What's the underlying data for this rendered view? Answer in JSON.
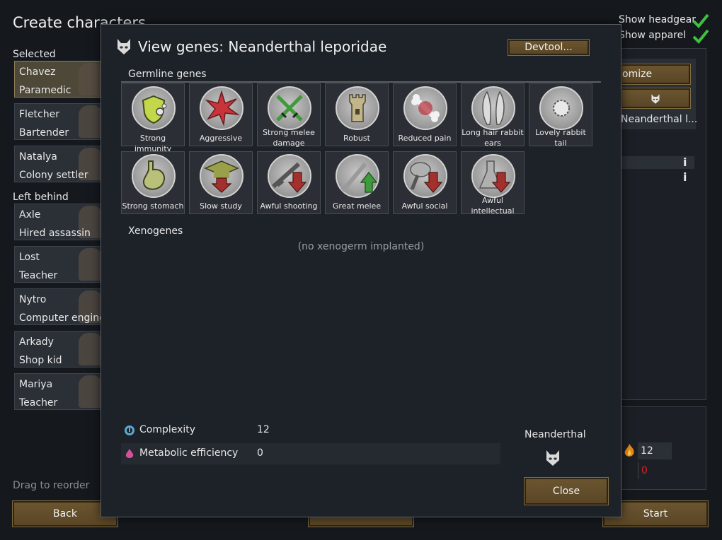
{
  "screen_title": "Create characters",
  "selected_label": "Selected",
  "left_behind_label": "Left behind",
  "selected_pawns": [
    {
      "name": "Chavez",
      "role": "Paramedic"
    },
    {
      "name": "Fletcher",
      "role": "Bartender"
    },
    {
      "name": "Natalya",
      "role": "Colony settler"
    }
  ],
  "left_behind_pawns": [
    {
      "name": "Axle",
      "role": "Hired assassin"
    },
    {
      "name": "Lost",
      "role": "Teacher"
    },
    {
      "name": "Nytro",
      "role": "Computer enginee"
    },
    {
      "name": "Arkady",
      "role": "Shop kid"
    },
    {
      "name": "Mariya",
      "role": "Teacher"
    }
  ],
  "drag_hint": "Drag to reorder",
  "back_label": "Back",
  "start_label": "Start",
  "show_headgear": "Show headgear",
  "show_apparel": "Show apparel",
  "right_panel": {
    "customize_partial": "omize",
    "xenotype_partial": "Neanderthal l...",
    "value_12": "12",
    "value_0": "0"
  },
  "dialog": {
    "title": "View genes: Neanderthal leporidae",
    "devtool_label": "Devtool...",
    "germline_label": "Germline genes",
    "xenogenes_label": "Xenogenes",
    "xenogenes_empty": "(no xenogerm implanted)",
    "germline_genes": [
      {
        "label": "Strong immunity",
        "icon": "shield-virus-icon"
      },
      {
        "label": "Aggressive",
        "icon": "anger-burst-icon"
      },
      {
        "label": "Strong melee damage",
        "icon": "crossed-swords-icon"
      },
      {
        "label": "Robust",
        "icon": "tower-icon"
      },
      {
        "label": "Reduced pain",
        "icon": "bone-icon"
      },
      {
        "label": "Long hair rabbit ears",
        "icon": "rabbit-ears-icon"
      },
      {
        "label": "Lovely rabbit tail",
        "icon": "fluffy-tail-icon"
      },
      {
        "label": "Strong stomach",
        "icon": "stomach-icon"
      },
      {
        "label": "Slow study",
        "icon": "graduation-cap-down-icon"
      },
      {
        "label": "Awful shooting",
        "icon": "rifle-down-icon"
      },
      {
        "label": "Great melee",
        "icon": "sword-up-icon"
      },
      {
        "label": "Awful social",
        "icon": "speech-down-icon"
      },
      {
        "label": "Awful intellectual",
        "icon": "flask-down-icon"
      }
    ],
    "stats": [
      {
        "label": "Complexity",
        "value": "12",
        "icon": "complexity-icon"
      },
      {
        "label": "Metabolic efficiency",
        "value": "0",
        "icon": "metabolism-drop-icon"
      }
    ],
    "xenotype_name": "Neanderthal",
    "close_label": "Close"
  },
  "colors": {
    "accent_green": "#3cc23c",
    "button_wood": "#6b5530",
    "dialog_bg": "#1d2228",
    "down_arrow_red": "#a3302c",
    "up_arrow_green": "#3e9a3c"
  }
}
